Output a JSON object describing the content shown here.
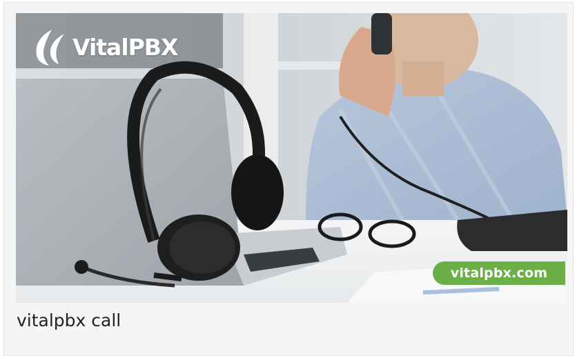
{
  "image": {
    "alt_subject": "headset-on-laptop-with-man-on-phone",
    "logo_text": "VitalPBX",
    "badge_text": "vitalpbx.com"
  },
  "caption": {
    "text": "vitalpbx call"
  },
  "colors": {
    "card_background": "#f5f5f5",
    "badge_green": "#6cae47",
    "caption_text": "#222222"
  }
}
